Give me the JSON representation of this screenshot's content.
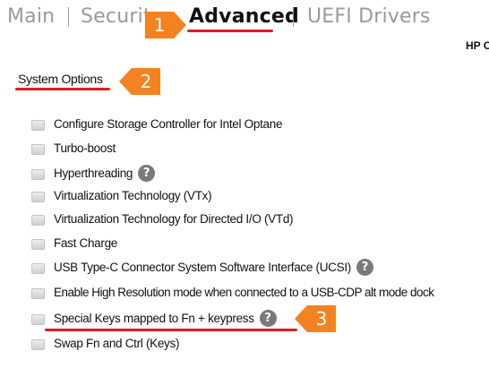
{
  "tabs": [
    {
      "label": "Main",
      "active": false
    },
    {
      "label": "Security",
      "active": false
    },
    {
      "label": "Advanced",
      "active": true
    },
    {
      "label": "UEFI Drivers",
      "active": false
    }
  ],
  "header": {
    "hp_label": "HP C"
  },
  "section": {
    "title": "System Options"
  },
  "options": [
    {
      "label": "Configure Storage Controller for Intel Optane",
      "checked": false,
      "help": false
    },
    {
      "label": "Turbo-boost",
      "checked": false,
      "help": false
    },
    {
      "label": "Hyperthreading",
      "checked": false,
      "help": true
    },
    {
      "label": "Virtualization Technology (VTx)",
      "checked": false,
      "help": false
    },
    {
      "label": "Virtualization Technology for Directed I/O (VTd)",
      "checked": false,
      "help": false
    },
    {
      "label": "Fast Charge",
      "checked": false,
      "help": false
    },
    {
      "label": "USB Type-C Connector System Software Interface (UCSI)",
      "checked": false,
      "help": true
    },
    {
      "label": "Enable High Resolution mode when connected to a USB-CDP alt mode dock",
      "checked": false,
      "help": false
    },
    {
      "label": "Special Keys mapped to Fn + keypress",
      "checked": false,
      "help": true
    },
    {
      "label": "Swap Fn and Ctrl (Keys)",
      "checked": false,
      "help": false
    }
  ],
  "help_glyph": "?",
  "callouts": [
    {
      "number": "1",
      "target": "Advanced tab"
    },
    {
      "number": "2",
      "target": "System Options"
    },
    {
      "number": "3",
      "target": "Special Keys mapped to Fn + keypress"
    }
  ],
  "colors": {
    "annotation": "#e31b23",
    "callout": "#f58220",
    "help": "#7a7a7a"
  }
}
